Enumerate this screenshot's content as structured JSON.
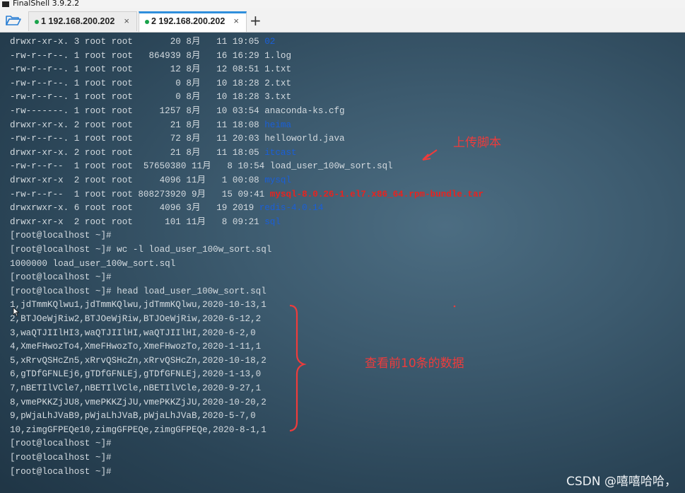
{
  "window": {
    "title": "FinalShell 3.9.2.2"
  },
  "tabs": [
    {
      "label": "1 192.168.200.202",
      "close": "×",
      "active": false
    },
    {
      "label": "2 192.168.200.202",
      "close": "×",
      "active": true
    }
  ],
  "new_tab_label": "+",
  "terminal": {
    "lines": [
      {
        "prefix": "drwxr-xr-x. 3 root root       20 8月   11 19:05 ",
        "name": "02",
        "kind": "dir"
      },
      {
        "prefix": "-rw-r--r--. 1 root root   864939 8月   16 16:29 ",
        "name": "1.log",
        "kind": "file"
      },
      {
        "prefix": "-rw-r--r--. 1 root root       12 8月   12 08:51 ",
        "name": "1.txt",
        "kind": "file"
      },
      {
        "prefix": "-rw-r--r--. 1 root root        0 8月   10 18:28 ",
        "name": "2.txt",
        "kind": "file"
      },
      {
        "prefix": "-rw-r--r--. 1 root root        0 8月   10 18:28 ",
        "name": "3.txt",
        "kind": "file"
      },
      {
        "prefix": "-rw-------. 1 root root     1257 8月   10 03:54 ",
        "name": "anaconda-ks.cfg",
        "kind": "file"
      },
      {
        "prefix": "drwxr-xr-x. 2 root root       21 8月   11 18:08 ",
        "name": "heima",
        "kind": "dir"
      },
      {
        "prefix": "-rw-r--r--. 1 root root       72 8月   11 20:03 ",
        "name": "helloworld.java",
        "kind": "file"
      },
      {
        "prefix": "drwxr-xr-x. 2 root root       21 8月   11 18:05 ",
        "name": "itcast",
        "kind": "dir"
      },
      {
        "prefix": "-rw-r--r--  1 root root  57650380 11月   8 10:54 ",
        "name": "load_user_100w_sort.sql",
        "kind": "file"
      },
      {
        "prefix": "drwxr-xr-x  2 root root     4096 11月   1 00:08 ",
        "name": "mysql",
        "kind": "dir"
      },
      {
        "prefix": "-rw-r--r--  1 root root 808273920 9月   15 09:41 ",
        "name": "mysql-8.0.26-1.el7.x86_64.rpm-bundle.tar",
        "kind": "archive"
      },
      {
        "prefix": "drwxrwxr-x. 6 root root     4096 3月   19 2019 ",
        "name": "redis-4.0.14",
        "kind": "dir"
      },
      {
        "prefix": "drwxr-xr-x  2 root root      101 11月   8 09:21 ",
        "name": "sql",
        "kind": "dir"
      },
      {
        "prefix": "[root@localhost ~]# ",
        "name": "",
        "kind": "prompt"
      },
      {
        "prefix": "[root@localhost ~]# wc -l load_user_100w_sort.sql",
        "name": "",
        "kind": "prompt"
      },
      {
        "prefix": "1000000 load_user_100w_sort.sql",
        "name": "",
        "kind": "output"
      },
      {
        "prefix": "[root@localhost ~]# ",
        "name": "",
        "kind": "prompt"
      },
      {
        "prefix": "[root@localhost ~]# head load_user_100w_sort.sql",
        "name": "",
        "kind": "prompt"
      },
      {
        "prefix": "1,jdTmmKQlwu1,jdTmmKQlwu,jdTmmKQlwu,2020-10-13,1",
        "name": "",
        "kind": "output"
      },
      {
        "prefix": "2,BTJOeWjRiw2,BTJOeWjRiw,BTJOeWjRiw,2020-6-12,2",
        "name": "",
        "kind": "output"
      },
      {
        "prefix": "3,waQTJIIlHI3,waQTJIIlHI,waQTJIIlHI,2020-6-2,0",
        "name": "",
        "kind": "output"
      },
      {
        "prefix": "4,XmeFHwozTo4,XmeFHwozTo,XmeFHwozTo,2020-1-11,1",
        "name": "",
        "kind": "output"
      },
      {
        "prefix": "5,xRrvQSHcZn5,xRrvQSHcZn,xRrvQSHcZn,2020-10-18,2",
        "name": "",
        "kind": "output"
      },
      {
        "prefix": "6,gTDfGFNLEj6,gTDfGFNLEj,gTDfGFNLEj,2020-1-13,0",
        "name": "",
        "kind": "output"
      },
      {
        "prefix": "7,nBETIlVCle7,nBETIlVCle,nBETIlVCle,2020-9-27,1",
        "name": "",
        "kind": "output"
      },
      {
        "prefix": "8,vmePKKZjJU8,vmePKKZjJU,vmePKKZjJU,2020-10-20,2",
        "name": "",
        "kind": "output"
      },
      {
        "prefix": "9,pWjaLhJVaB9,pWjaLhJVaB,pWjaLhJVaB,2020-5-7,0",
        "name": "",
        "kind": "output"
      },
      {
        "prefix": "10,zimgGFPEQe10,zimgGFPEQe,zimgGFPEQe,2020-8-1,1",
        "name": "",
        "kind": "output"
      },
      {
        "prefix": "[root@localhost ~]# ",
        "name": "",
        "kind": "prompt"
      },
      {
        "prefix": "[root@localhost ~]# ",
        "name": "",
        "kind": "prompt"
      },
      {
        "prefix": "[root@localhost ~]# ",
        "name": "",
        "kind": "prompt"
      }
    ]
  },
  "annotations": {
    "upload": "上传脚本",
    "view_top10": "查看前10条的数据"
  },
  "colors": {
    "annotation": "#ef3b3b",
    "dir_name": "#1a5fd8",
    "archive_name": "#e8231f",
    "terminal_text": "#d4dbe0",
    "active_tab_accent": "#2f8fdc",
    "status_dot": "#19a34a"
  },
  "icons": [
    "app-icon",
    "folder-open-icon",
    "connection-status-icon",
    "close-icon",
    "plus-icon",
    "mouse-cursor-icon"
  ],
  "watermark": "CSDN @嘻嘻哈哈，"
}
